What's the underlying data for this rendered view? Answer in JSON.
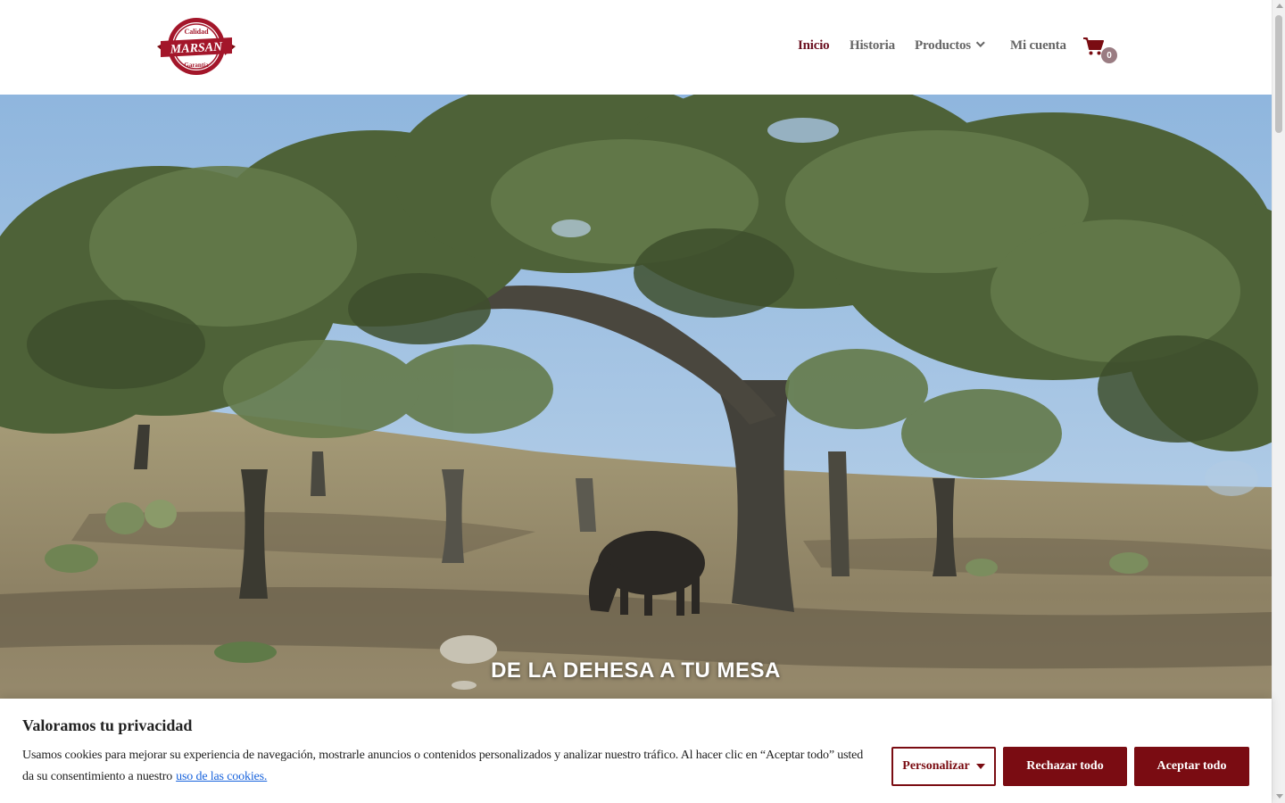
{
  "header": {
    "logo": {
      "line1": "Calidad",
      "brand": "MARSAN",
      "line3": "Garantía"
    },
    "nav": [
      {
        "label": "Inicio",
        "active": true
      },
      {
        "label": "Historia",
        "active": false
      },
      {
        "label": "Productos",
        "active": false,
        "dropdown": true
      },
      {
        "label": "Mi cuenta",
        "active": false
      }
    ],
    "cart": {
      "icon": "shopping-cart-icon",
      "count": "0"
    }
  },
  "hero": {
    "title": "DE LA DEHESA A TU MESA"
  },
  "cookie_banner": {
    "title": "Valoramos tu privacidad",
    "text": "Usamos cookies para mejorar su experiencia de navegación, mostrarle anuncios o contenidos personalizados y analizar nuestro tráfico. Al hacer clic en “Aceptar todo” usted da su consentimiento a nuestro",
    "link": "uso de las cookies.",
    "buttons": {
      "customize": "Personalizar",
      "reject": "Rechazar todo",
      "accept": "Aceptar todo"
    }
  },
  "colors": {
    "brand": "#7a0c12",
    "nav_active": "#6b1020",
    "nav_default": "#666666",
    "link": "#1863dc"
  }
}
